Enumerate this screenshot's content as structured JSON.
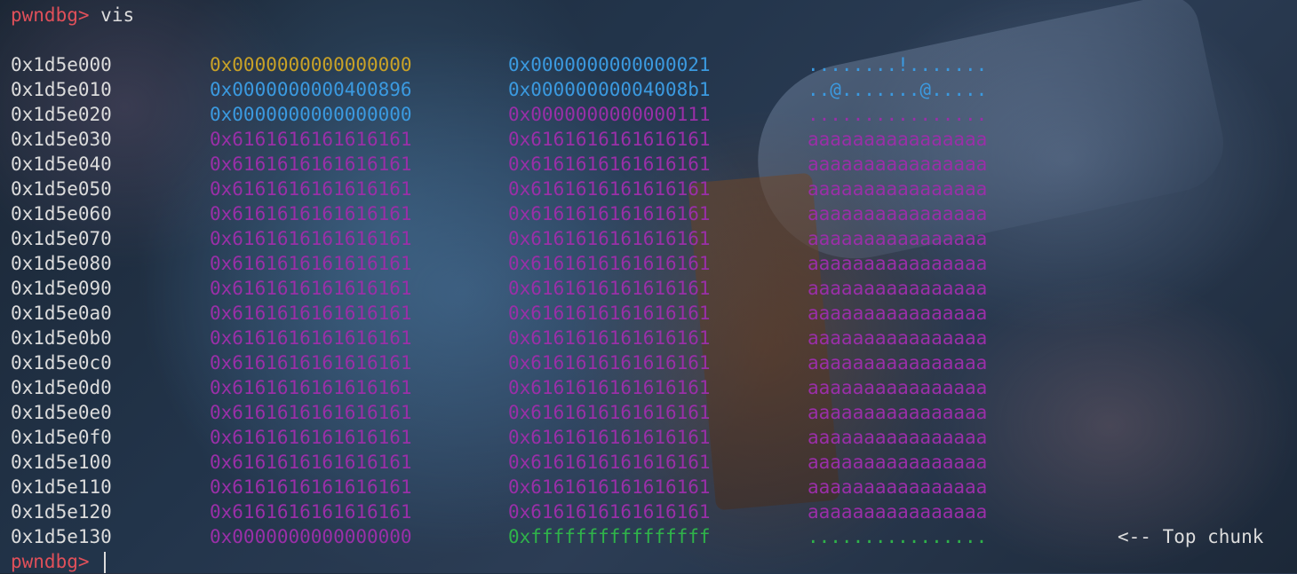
{
  "terminal": {
    "prompt": "pwndbg>",
    "command": "vis",
    "final_prompt": "pwndbg>"
  },
  "colors": {
    "prompt": "#e0505a",
    "text": "#dcdcdc",
    "yellow": "#c9a227",
    "blue": "#3b9ae0",
    "magenta": "#9a2fa8",
    "green": "#2fb34a"
  },
  "rows": [
    {
      "addr": "0x1d5e000",
      "w1": "0x0000000000000000",
      "w2": "0x0000000000000021",
      "ascii": "........!.......",
      "c1": "#c9a227",
      "c2": "#3b9ae0",
      "ca": "#3b9ae0",
      "note": ""
    },
    {
      "addr": "0x1d5e010",
      "w1": "0x0000000000400896",
      "w2": "0x00000000004008b1",
      "ascii": "..@.......@.....",
      "c1": "#3b9ae0",
      "c2": "#3b9ae0",
      "ca": "#3b9ae0",
      "note": ""
    },
    {
      "addr": "0x1d5e020",
      "w1": "0x0000000000000000",
      "w2": "0x0000000000000111",
      "ascii": "................",
      "c1": "#3b9ae0",
      "c2": "#9a2fa8",
      "ca": "#9a2fa8",
      "note": ""
    },
    {
      "addr": "0x1d5e030",
      "w1": "0x6161616161616161",
      "w2": "0x6161616161616161",
      "ascii": "aaaaaaaaaaaaaaaa",
      "c1": "#9a2fa8",
      "c2": "#9a2fa8",
      "ca": "#9a2fa8",
      "note": ""
    },
    {
      "addr": "0x1d5e040",
      "w1": "0x6161616161616161",
      "w2": "0x6161616161616161",
      "ascii": "aaaaaaaaaaaaaaaa",
      "c1": "#9a2fa8",
      "c2": "#9a2fa8",
      "ca": "#9a2fa8",
      "note": ""
    },
    {
      "addr": "0x1d5e050",
      "w1": "0x6161616161616161",
      "w2": "0x6161616161616161",
      "ascii": "aaaaaaaaaaaaaaaa",
      "c1": "#9a2fa8",
      "c2": "#9a2fa8",
      "ca": "#9a2fa8",
      "note": ""
    },
    {
      "addr": "0x1d5e060",
      "w1": "0x6161616161616161",
      "w2": "0x6161616161616161",
      "ascii": "aaaaaaaaaaaaaaaa",
      "c1": "#9a2fa8",
      "c2": "#9a2fa8",
      "ca": "#9a2fa8",
      "note": ""
    },
    {
      "addr": "0x1d5e070",
      "w1": "0x6161616161616161",
      "w2": "0x6161616161616161",
      "ascii": "aaaaaaaaaaaaaaaa",
      "c1": "#9a2fa8",
      "c2": "#9a2fa8",
      "ca": "#9a2fa8",
      "note": ""
    },
    {
      "addr": "0x1d5e080",
      "w1": "0x6161616161616161",
      "w2": "0x6161616161616161",
      "ascii": "aaaaaaaaaaaaaaaa",
      "c1": "#9a2fa8",
      "c2": "#9a2fa8",
      "ca": "#9a2fa8",
      "note": ""
    },
    {
      "addr": "0x1d5e090",
      "w1": "0x6161616161616161",
      "w2": "0x6161616161616161",
      "ascii": "aaaaaaaaaaaaaaaa",
      "c1": "#9a2fa8",
      "c2": "#9a2fa8",
      "ca": "#9a2fa8",
      "note": ""
    },
    {
      "addr": "0x1d5e0a0",
      "w1": "0x6161616161616161",
      "w2": "0x6161616161616161",
      "ascii": "aaaaaaaaaaaaaaaa",
      "c1": "#9a2fa8",
      "c2": "#9a2fa8",
      "ca": "#9a2fa8",
      "note": ""
    },
    {
      "addr": "0x1d5e0b0",
      "w1": "0x6161616161616161",
      "w2": "0x6161616161616161",
      "ascii": "aaaaaaaaaaaaaaaa",
      "c1": "#9a2fa8",
      "c2": "#9a2fa8",
      "ca": "#9a2fa8",
      "note": ""
    },
    {
      "addr": "0x1d5e0c0",
      "w1": "0x6161616161616161",
      "w2": "0x6161616161616161",
      "ascii": "aaaaaaaaaaaaaaaa",
      "c1": "#9a2fa8",
      "c2": "#9a2fa8",
      "ca": "#9a2fa8",
      "note": ""
    },
    {
      "addr": "0x1d5e0d0",
      "w1": "0x6161616161616161",
      "w2": "0x6161616161616161",
      "ascii": "aaaaaaaaaaaaaaaa",
      "c1": "#9a2fa8",
      "c2": "#9a2fa8",
      "ca": "#9a2fa8",
      "note": ""
    },
    {
      "addr": "0x1d5e0e0",
      "w1": "0x6161616161616161",
      "w2": "0x6161616161616161",
      "ascii": "aaaaaaaaaaaaaaaa",
      "c1": "#9a2fa8",
      "c2": "#9a2fa8",
      "ca": "#9a2fa8",
      "note": ""
    },
    {
      "addr": "0x1d5e0f0",
      "w1": "0x6161616161616161",
      "w2": "0x6161616161616161",
      "ascii": "aaaaaaaaaaaaaaaa",
      "c1": "#9a2fa8",
      "c2": "#9a2fa8",
      "ca": "#9a2fa8",
      "note": ""
    },
    {
      "addr": "0x1d5e100",
      "w1": "0x6161616161616161",
      "w2": "0x6161616161616161",
      "ascii": "aaaaaaaaaaaaaaaa",
      "c1": "#9a2fa8",
      "c2": "#9a2fa8",
      "ca": "#9a2fa8",
      "note": ""
    },
    {
      "addr": "0x1d5e110",
      "w1": "0x6161616161616161",
      "w2": "0x6161616161616161",
      "ascii": "aaaaaaaaaaaaaaaa",
      "c1": "#9a2fa8",
      "c2": "#9a2fa8",
      "ca": "#9a2fa8",
      "note": ""
    },
    {
      "addr": "0x1d5e120",
      "w1": "0x6161616161616161",
      "w2": "0x6161616161616161",
      "ascii": "aaaaaaaaaaaaaaaa",
      "c1": "#9a2fa8",
      "c2": "#9a2fa8",
      "ca": "#9a2fa8",
      "note": ""
    },
    {
      "addr": "0x1d5e130",
      "w1": "0x0000000000000000",
      "w2": "0xffffffffffffffff",
      "ascii": "................",
      "c1": "#9a2fa8",
      "c2": "#2fb34a",
      "ca": "#2fb34a",
      "note": "<-- Top chunk"
    }
  ]
}
